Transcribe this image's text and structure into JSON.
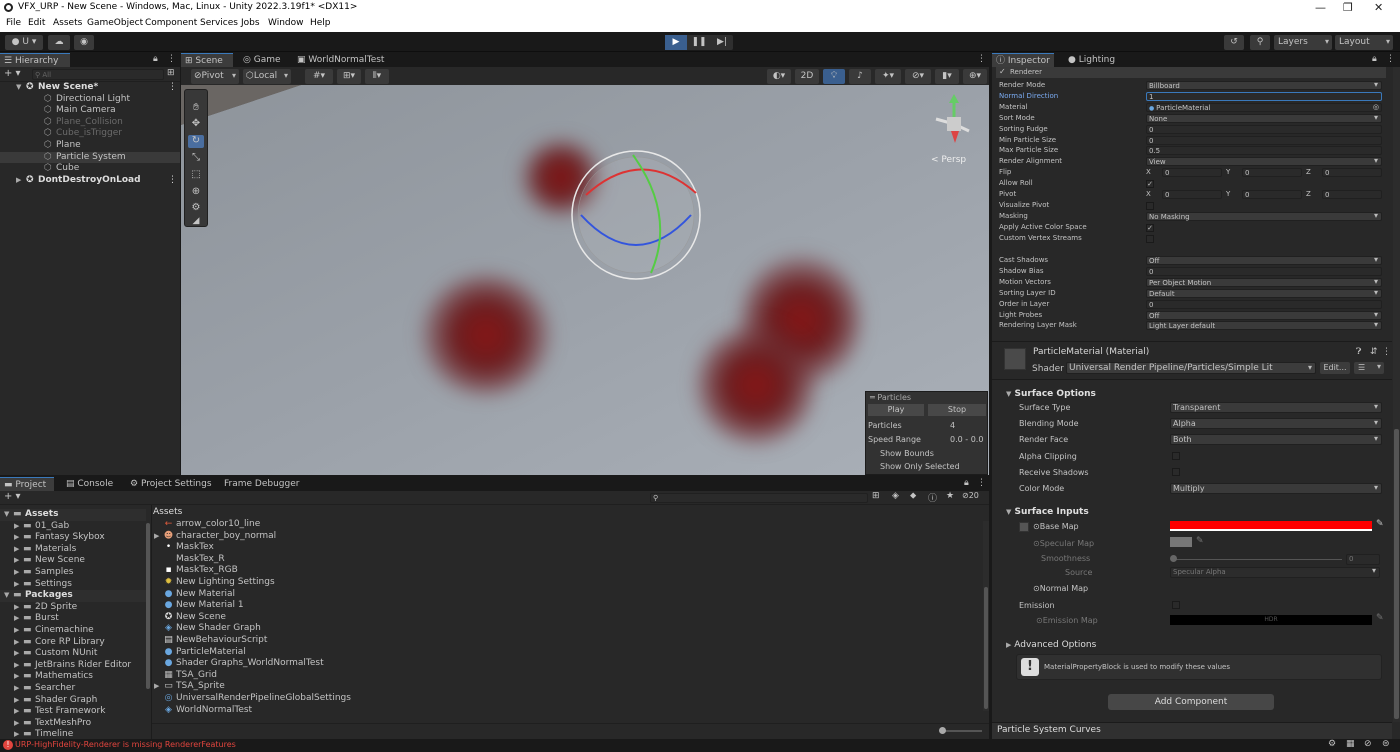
{
  "window": {
    "title": "VFX_URP - New Scene - Windows, Mac, Linux - Unity 2022.3.19f1* <DX11>",
    "controls": [
      "—",
      "❐",
      "✕"
    ]
  },
  "menu": [
    "File",
    "Edit",
    "Assets",
    "GameObject",
    "Component",
    "Services",
    "Jobs",
    "Window",
    "Help"
  ],
  "toolbar": {
    "account": "U ▾",
    "play": "▶",
    "pause": "❚❚",
    "step": "▶|",
    "layers": "Layers",
    "layout": "Layout"
  },
  "hierarchy": {
    "tab": "Hierarchy",
    "search_placeholder": "All",
    "add": "+ ▾",
    "items": [
      {
        "label": "New Scene*",
        "state": "scene"
      },
      {
        "label": "Directional Light",
        "state": "normal"
      },
      {
        "label": "Main Camera",
        "state": "normal"
      },
      {
        "label": "Plane_Collision",
        "state": "disabled"
      },
      {
        "label": "Cube_isTrigger",
        "state": "disabled"
      },
      {
        "label": "Plane",
        "state": "normal"
      },
      {
        "label": "Particle System",
        "state": "selected"
      },
      {
        "label": "Cube",
        "state": "normal"
      },
      {
        "label": "DontDestroyOnLoad",
        "state": "scene"
      }
    ]
  },
  "scene": {
    "tabs": [
      "Scene",
      "Game",
      "WorldNormalTest"
    ],
    "pivot": "Pivot",
    "local": "Local",
    "mode_2d": "2D",
    "persp": "< Persp",
    "particles_overlay": {
      "title": "Particles",
      "play": "Play",
      "stop": "Stop",
      "rows": [
        {
          "label": "Particles",
          "value": "4"
        },
        {
          "label": "Speed Range",
          "value": "0.0 - 0.0"
        }
      ],
      "show_bounds": "Show Bounds",
      "show_only_selected": "Show Only Selected"
    }
  },
  "project": {
    "tabs": [
      "Project",
      "Console",
      "Project Settings",
      "Frame Debugger"
    ],
    "add": "+ ▾",
    "hidden_count": "20",
    "breadcrumb": "Assets",
    "tree": [
      {
        "label": "Assets",
        "level": 0,
        "bold": true
      },
      {
        "label": "01_Gab",
        "level": 1
      },
      {
        "label": "Fantasy Skybox",
        "level": 1
      },
      {
        "label": "Materials",
        "level": 1
      },
      {
        "label": "New Scene",
        "level": 1
      },
      {
        "label": "Samples",
        "level": 1
      },
      {
        "label": "Settings",
        "level": 1
      },
      {
        "label": "Packages",
        "level": 0,
        "bold": true
      },
      {
        "label": "2D Sprite",
        "level": 1
      },
      {
        "label": "Burst",
        "level": 1
      },
      {
        "label": "Cinemachine",
        "level": 1
      },
      {
        "label": "Core RP Library",
        "level": 1
      },
      {
        "label": "Custom NUnit",
        "level": 1
      },
      {
        "label": "JetBrains Rider Editor",
        "level": 1
      },
      {
        "label": "Mathematics",
        "level": 1
      },
      {
        "label": "Searcher",
        "level": 1
      },
      {
        "label": "Shader Graph",
        "level": 1
      },
      {
        "label": "Test Framework",
        "level": 1
      },
      {
        "label": "TextMeshPro",
        "level": 1
      },
      {
        "label": "Timeline",
        "level": 1
      }
    ],
    "assets": [
      {
        "label": "arrow_color10_line",
        "icon": "arrow"
      },
      {
        "label": "character_boy_normal",
        "icon": "prefab"
      },
      {
        "label": "MaskTex",
        "icon": "dot"
      },
      {
        "label": "MaskTex_R",
        "icon": "none"
      },
      {
        "label": "MaskTex_RGB",
        "icon": "tex"
      },
      {
        "label": "New Lighting Settings",
        "icon": "light"
      },
      {
        "label": "New Material",
        "icon": "mat"
      },
      {
        "label": "New Material 1",
        "icon": "mat"
      },
      {
        "label": "New Scene",
        "icon": "scene"
      },
      {
        "label": "New Shader Graph",
        "icon": "shader"
      },
      {
        "label": "NewBehaviourScript",
        "icon": "script"
      },
      {
        "label": "ParticleMaterial",
        "icon": "mat"
      },
      {
        "label": "Shader Graphs_WorldNormalTest",
        "icon": "mat"
      },
      {
        "label": "TSA_Grid",
        "icon": "grid"
      },
      {
        "label": "TSA_Sprite",
        "icon": "sprite"
      },
      {
        "label": "UniversalRenderPipelineGlobalSettings",
        "icon": "settings"
      },
      {
        "label": "WorldNormalTest",
        "icon": "shader"
      }
    ]
  },
  "status": {
    "message": "URP-HighFidelity-Renderer is missing RendererFeatures",
    "color": "#e2453e"
  },
  "inspector": {
    "tabs": [
      "Inspector",
      "Lighting"
    ],
    "module_title": "Renderer",
    "fields": [
      {
        "label": "Render Mode",
        "value": "Billboard",
        "kind": "dropdown"
      },
      {
        "label": "Normal Direction",
        "value": "1",
        "kind": "text",
        "highlight": true
      },
      {
        "label": "Material",
        "value": "ParticleMaterial",
        "kind": "object"
      },
      {
        "label": "Sort Mode",
        "value": "None",
        "kind": "dropdown"
      },
      {
        "label": "Sorting Fudge",
        "value": "0",
        "kind": "text"
      },
      {
        "label": "Min Particle Size",
        "value": "0",
        "kind": "text"
      },
      {
        "label": "Max Particle Size",
        "value": "0.5",
        "kind": "text"
      },
      {
        "label": "Render Alignment",
        "value": "View",
        "kind": "dropdown"
      },
      {
        "label": "Flip",
        "kind": "xyz",
        "x": "0",
        "y": "0",
        "z": "0"
      },
      {
        "label": "Allow Roll",
        "kind": "check",
        "checked": true
      },
      {
        "label": "Pivot",
        "kind": "xyz",
        "x": "0",
        "y": "0",
        "z": "0"
      },
      {
        "label": "Visualize Pivot",
        "kind": "check",
        "checked": false
      },
      {
        "label": "Masking",
        "value": "No Masking",
        "kind": "dropdown"
      },
      {
        "label": "Apply Active Color Space",
        "kind": "check",
        "checked": true
      },
      {
        "label": "Custom Vertex Streams",
        "kind": "check",
        "checked": false
      },
      {
        "label": "Cast Shadows",
        "value": "Off",
        "kind": "dropdown"
      },
      {
        "label": "Shadow Bias",
        "value": "0",
        "kind": "text"
      },
      {
        "label": "Motion Vectors",
        "value": "Per Object Motion",
        "kind": "dropdown"
      },
      {
        "label": "Sorting Layer ID",
        "value": "Default",
        "kind": "dropdown"
      },
      {
        "label": "Order in Layer",
        "value": "0",
        "kind": "text"
      },
      {
        "label": "Light Probes",
        "value": "Off",
        "kind": "dropdown"
      },
      {
        "label": "Rendering Layer Mask",
        "value": "Light Layer default",
        "kind": "dropdown"
      }
    ],
    "material": {
      "name": "ParticleMaterial (Material)",
      "shader_label": "Shader",
      "shader": "Universal Render Pipeline/Particles/Simple Lit",
      "edit": "Edit...",
      "surface_options": "Surface Options",
      "options": [
        {
          "label": "Surface Type",
          "value": "Transparent",
          "kind": "dropdown"
        },
        {
          "label": "Blending Mode",
          "value": "Alpha",
          "kind": "dropdown"
        },
        {
          "label": "Render Face",
          "value": "Both",
          "kind": "dropdown"
        },
        {
          "label": "Alpha Clipping",
          "kind": "check"
        },
        {
          "label": "Receive Shadows",
          "kind": "check"
        },
        {
          "label": "Color Mode",
          "value": "Multiply",
          "kind": "dropdown"
        }
      ],
      "surface_inputs": "Surface Inputs",
      "base_map": "Base Map",
      "base_color": "#ff0000",
      "specular_map": "Specular Map",
      "smoothness": "Smoothness",
      "smoothness_value": "0",
      "source": "Source",
      "source_value": "Specular Alpha",
      "normal_map": "Normal Map",
      "emission": "Emission",
      "emission_map": "Emission Map",
      "hdr": "HDR",
      "advanced": "Advanced Options",
      "info": "MaterialPropertyBlock is used to modify these values"
    },
    "add_component": "Add Component",
    "curves": "Particle System Curves"
  }
}
